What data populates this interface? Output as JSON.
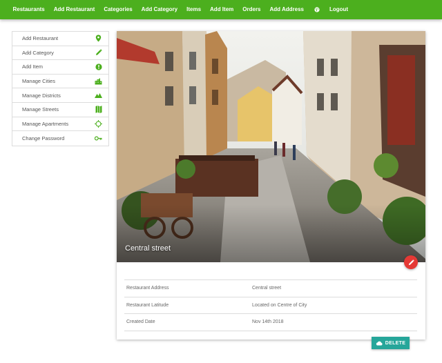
{
  "nav": {
    "items": [
      {
        "label": "Restaurants"
      },
      {
        "label": "Add Restaurant"
      },
      {
        "label": "Categories"
      },
      {
        "label": "Add Category"
      },
      {
        "label": "Items"
      },
      {
        "label": "Add Item"
      },
      {
        "label": "Orders"
      },
      {
        "label": "Add Address"
      }
    ],
    "icon": "globe-icon",
    "logout": "Logout"
  },
  "sidebar": {
    "items": [
      {
        "label": "Add Restaurant",
        "icon": "location-pin-icon"
      },
      {
        "label": "Add Category",
        "icon": "pencil-icon"
      },
      {
        "label": "Add Item",
        "icon": "info-circle-icon"
      },
      {
        "label": "Manage Cities",
        "icon": "city-icon"
      },
      {
        "label": "Manage Districts",
        "icon": "terrain-icon"
      },
      {
        "label": "Manage Streets",
        "icon": "map-icon"
      },
      {
        "label": "Manage Apartments",
        "icon": "crosshair-icon"
      },
      {
        "label": "Change Password",
        "icon": "key-icon"
      }
    ]
  },
  "card": {
    "caption": "Central street",
    "edit_icon": "pencil-icon",
    "details": [
      {
        "label": "Restaurant Address",
        "value": "Central street"
      },
      {
        "label": "Restaurant Latitude",
        "value": "Located on Centre of City"
      },
      {
        "label": "Created Date",
        "value": "Nov 14th 2018"
      }
    ]
  },
  "delete_button": {
    "label": "DELETE",
    "icon": "cloud-icon"
  },
  "colors": {
    "nav_bg": "#4caf1e",
    "icon_green": "#4caf1e",
    "fab_red": "#e53935",
    "delete_teal": "#26a69a"
  }
}
